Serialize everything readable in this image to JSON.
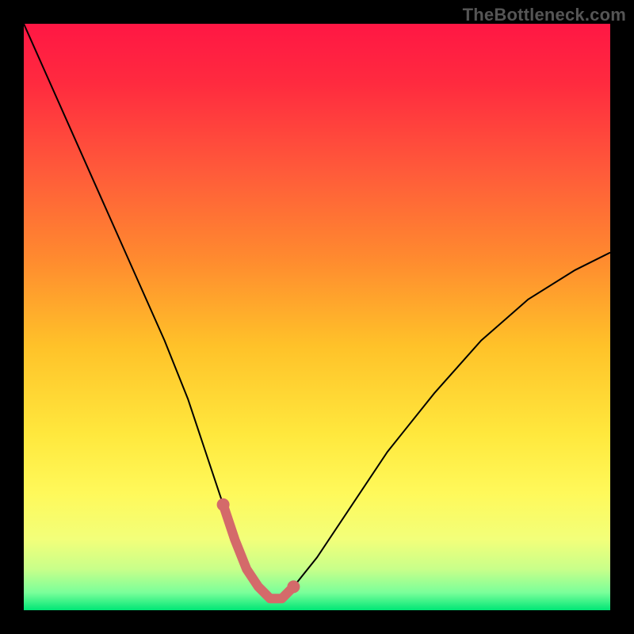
{
  "watermark": "TheBottleneck.com",
  "colors": {
    "background": "#000000",
    "watermark_text": "#555555",
    "curve_stroke": "#000000",
    "highlight_stroke": "#d46a6a",
    "gradient_stops": [
      {
        "offset": 0.0,
        "color": "#ff1744"
      },
      {
        "offset": 0.1,
        "color": "#ff2a3f"
      },
      {
        "offset": 0.25,
        "color": "#ff5a3a"
      },
      {
        "offset": 0.4,
        "color": "#ff8a2f"
      },
      {
        "offset": 0.55,
        "color": "#ffc229"
      },
      {
        "offset": 0.7,
        "color": "#ffe83d"
      },
      {
        "offset": 0.8,
        "color": "#fff95a"
      },
      {
        "offset": 0.88,
        "color": "#f2ff7a"
      },
      {
        "offset": 0.93,
        "color": "#c8ff8a"
      },
      {
        "offset": 0.97,
        "color": "#7aff9a"
      },
      {
        "offset": 1.0,
        "color": "#00e676"
      }
    ]
  },
  "chart_data": {
    "type": "line",
    "title": "",
    "xlabel": "",
    "ylabel": "",
    "xlim": [
      0,
      100
    ],
    "ylim": [
      0,
      100
    ],
    "series": [
      {
        "name": "bottleneck-curve",
        "x": [
          0,
          4,
          8,
          12,
          16,
          20,
          24,
          28,
          30,
          32,
          34,
          36,
          38,
          40,
          42,
          44,
          46,
          50,
          56,
          62,
          70,
          78,
          86,
          94,
          100
        ],
        "y": [
          100,
          91,
          82,
          73,
          64,
          55,
          46,
          36,
          30,
          24,
          18,
          12,
          7,
          4,
          2,
          2,
          4,
          9,
          18,
          27,
          37,
          46,
          53,
          58,
          61
        ]
      },
      {
        "name": "optimal-segment",
        "x": [
          34,
          36,
          38,
          40,
          42,
          44,
          46
        ],
        "y": [
          18,
          12,
          7,
          4,
          2,
          2,
          4
        ]
      }
    ],
    "annotations": []
  }
}
